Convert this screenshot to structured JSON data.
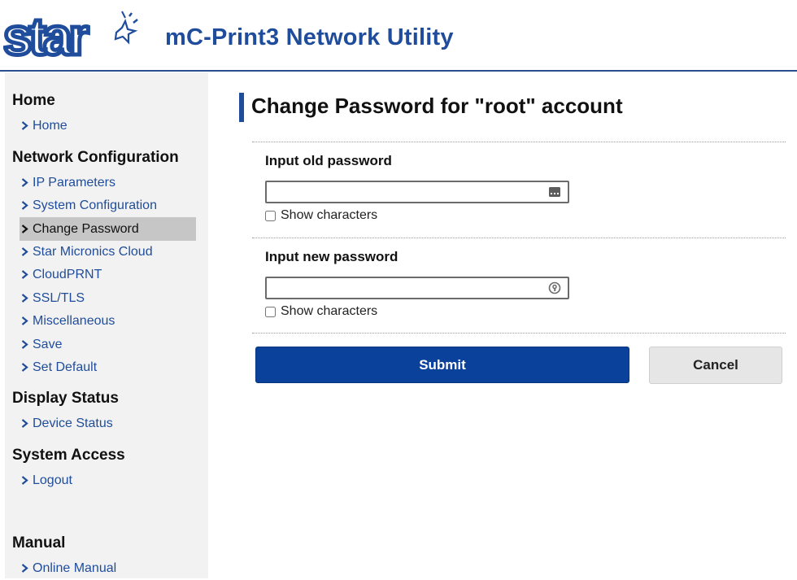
{
  "header": {
    "logo_text": "star",
    "title": "mC-Print3 Network Utility",
    "brand_color": "#1f4d9b"
  },
  "sidebar": {
    "sections": [
      {
        "heading": "Home",
        "items": [
          {
            "label": "Home"
          }
        ]
      },
      {
        "heading": "Network Configuration",
        "items": [
          {
            "label": "IP Parameters"
          },
          {
            "label": "System Configuration"
          },
          {
            "label": "Change Password",
            "active": true
          },
          {
            "label": "Star Micronics Cloud"
          },
          {
            "label": "CloudPRNT"
          },
          {
            "label": "SSL/TLS"
          },
          {
            "label": "Miscellaneous"
          },
          {
            "label": "Save"
          },
          {
            "label": "Set Default"
          }
        ]
      },
      {
        "heading": "Display Status",
        "items": [
          {
            "label": "Device Status"
          }
        ]
      },
      {
        "heading": "System Access",
        "items": [
          {
            "label": "Logout"
          }
        ]
      },
      {
        "heading": "Manual",
        "items": [
          {
            "label": "Online Manual"
          }
        ]
      }
    ]
  },
  "main": {
    "page_title": "Change Password for \"root\" account",
    "old_password": {
      "label": "Input old password",
      "value": "",
      "show_characters_label": "Show characters",
      "show_characters_checked": false,
      "icon": "password-manager-icon"
    },
    "new_password": {
      "label": "Input new password",
      "value": "",
      "show_characters_label": "Show characters",
      "show_characters_checked": false,
      "icon": "key-generator-icon"
    },
    "submit_label": "Submit",
    "cancel_label": "Cancel",
    "submit_color": "#0a419b"
  }
}
